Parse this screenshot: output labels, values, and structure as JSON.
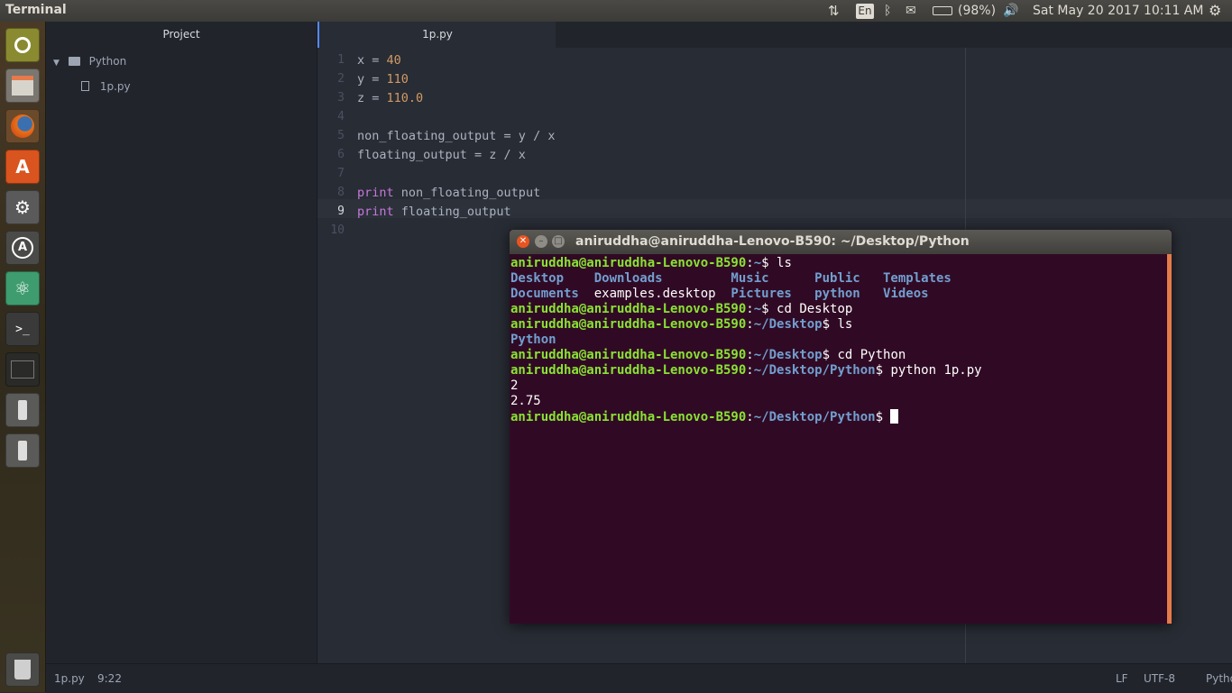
{
  "top_panel": {
    "app_title": "Terminal",
    "keyboard_layout": "En",
    "battery": "(98%)",
    "datetime": "Sat May 20 2017",
    "time": "10:11 AM",
    "icons": [
      "network-updown-icon",
      "keyboard-layout-icon",
      "bluetooth-icon",
      "mail-icon",
      "battery-icon",
      "volume-icon",
      "gear-icon"
    ]
  },
  "launcher": {
    "items": [
      "dash-home-icon",
      "files-icon",
      "firefox-icon",
      "software-center-icon",
      "system-settings-icon",
      "software-updater-icon",
      "atom-icon",
      "terminal-icon",
      "workspace-switcher-icon",
      "usb-drive-icon",
      "usb-drive-icon",
      "trash-icon"
    ]
  },
  "editor": {
    "tree": {
      "header": "Project",
      "folder": "Python",
      "file": "1p.py"
    },
    "tab": "1p.py",
    "lines": [
      {
        "n": "1",
        "parts": [
          [
            "x = ",
            ""
          ],
          [
            "40",
            "num"
          ]
        ]
      },
      {
        "n": "2",
        "parts": [
          [
            "y = ",
            ""
          ],
          [
            "110",
            "num"
          ]
        ]
      },
      {
        "n": "3",
        "parts": [
          [
            "z = ",
            ""
          ],
          [
            "110.0",
            "num"
          ]
        ]
      },
      {
        "n": "4",
        "parts": []
      },
      {
        "n": "5",
        "parts": [
          [
            "non_floating_output = y / x",
            ""
          ]
        ]
      },
      {
        "n": "6",
        "parts": [
          [
            "floating_output = z / x",
            ""
          ]
        ]
      },
      {
        "n": "7",
        "parts": []
      },
      {
        "n": "8",
        "parts": [
          [
            "print",
            "kw"
          ],
          [
            " non_floating_output",
            ""
          ]
        ]
      },
      {
        "n": "9",
        "parts": [
          [
            "print",
            "kw"
          ],
          [
            " floating_output",
            ""
          ]
        ]
      },
      {
        "n": "10",
        "parts": []
      }
    ],
    "status": {
      "file": "1p.py",
      "cursor": "9:22",
      "line_ending": "LF",
      "encoding": "UTF-8",
      "grammar": "Python"
    }
  },
  "terminal": {
    "title": "aniruddha@aniruddha-Lenovo-B590: ~/Desktop/Python",
    "lines": [
      [
        [
          "aniruddha@aniruddha-Lenovo-B590",
          "tg"
        ],
        [
          ":",
          "tw"
        ],
        [
          "~",
          "tb"
        ],
        [
          "$ ls",
          "tw"
        ]
      ],
      [
        [
          "Desktop    Downloads         Music      Public   Templates",
          "tb"
        ]
      ],
      [
        [
          "Documents  ",
          "tb"
        ],
        [
          "examples.desktop",
          "tw"
        ],
        [
          "  Pictures   python   Videos",
          "tb"
        ]
      ],
      [
        [
          "aniruddha@aniruddha-Lenovo-B590",
          "tg"
        ],
        [
          ":",
          "tw"
        ],
        [
          "~",
          "tb"
        ],
        [
          "$ cd Desktop",
          "tw"
        ]
      ],
      [
        [
          "aniruddha@aniruddha-Lenovo-B590",
          "tg"
        ],
        [
          ":",
          "tw"
        ],
        [
          "~/Desktop",
          "tb"
        ],
        [
          "$ ls",
          "tw"
        ]
      ],
      [
        [
          "Python",
          "tb"
        ]
      ],
      [
        [
          "aniruddha@aniruddha-Lenovo-B590",
          "tg"
        ],
        [
          ":",
          "tw"
        ],
        [
          "~/Desktop",
          "tb"
        ],
        [
          "$ cd Python",
          "tw"
        ]
      ],
      [
        [
          "aniruddha@aniruddha-Lenovo-B590",
          "tg"
        ],
        [
          ":",
          "tw"
        ],
        [
          "~/Desktop/Python",
          "tb"
        ],
        [
          "$ python 1p.py",
          "tw"
        ]
      ],
      [
        [
          "2",
          "tw"
        ]
      ],
      [
        [
          "2.75",
          "tw"
        ]
      ],
      [
        [
          "aniruddha@aniruddha-Lenovo-B590",
          "tg"
        ],
        [
          ":",
          "tw"
        ],
        [
          "~/Desktop/Python",
          "tb"
        ],
        [
          "$ ",
          "tw"
        ]
      ]
    ]
  }
}
